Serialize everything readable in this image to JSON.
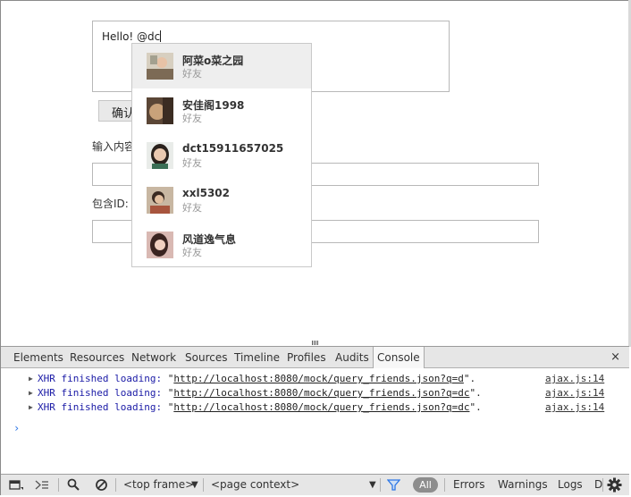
{
  "page": {
    "textarea_value": "Hello! @dc",
    "confirm_label": "确认",
    "label_input_content": "输入内容:",
    "label_contains_id": "包含ID:"
  },
  "dropdown": {
    "items": [
      {
        "name": "阿菜o菜之园",
        "subtitle": "好友",
        "active": true
      },
      {
        "name": "安佳阁1998",
        "subtitle": "好友",
        "active": false
      },
      {
        "name": "dct15911657025",
        "subtitle": "好友",
        "active": false
      },
      {
        "name": "xxl5302",
        "subtitle": "好友",
        "active": false
      },
      {
        "name": "风道逸气息",
        "subtitle": "好友",
        "active": false
      }
    ]
  },
  "devtools": {
    "tabs": [
      "Elements",
      "Resources",
      "Network",
      "Sources",
      "Timeline",
      "Profiles",
      "Audits",
      "Console"
    ],
    "active_tab": "Console",
    "close_glyph": "×",
    "console_logs": [
      {
        "prefix": "XHR finished loading: ",
        "url": "http://localhost:8080/mock/query_friends.json?q=d",
        "suffix": ".",
        "source": "ajax.js:14"
      },
      {
        "prefix": "XHR finished loading: ",
        "url": "http://localhost:8080/mock/query_friends.json?q=dc",
        "suffix": ".",
        "source": "ajax.js:14"
      },
      {
        "prefix": "XHR finished loading: ",
        "url": "http://localhost:8080/mock/query_friends.json?q=dc",
        "suffix": ".",
        "source": "ajax.js:14"
      }
    ],
    "prompt": "›",
    "bottom": {
      "frame_select": "<top frame>",
      "context_select": "<page context>",
      "filter_all": "All",
      "filters": [
        "Errors",
        "Warnings",
        "Logs",
        "D"
      ]
    }
  }
}
